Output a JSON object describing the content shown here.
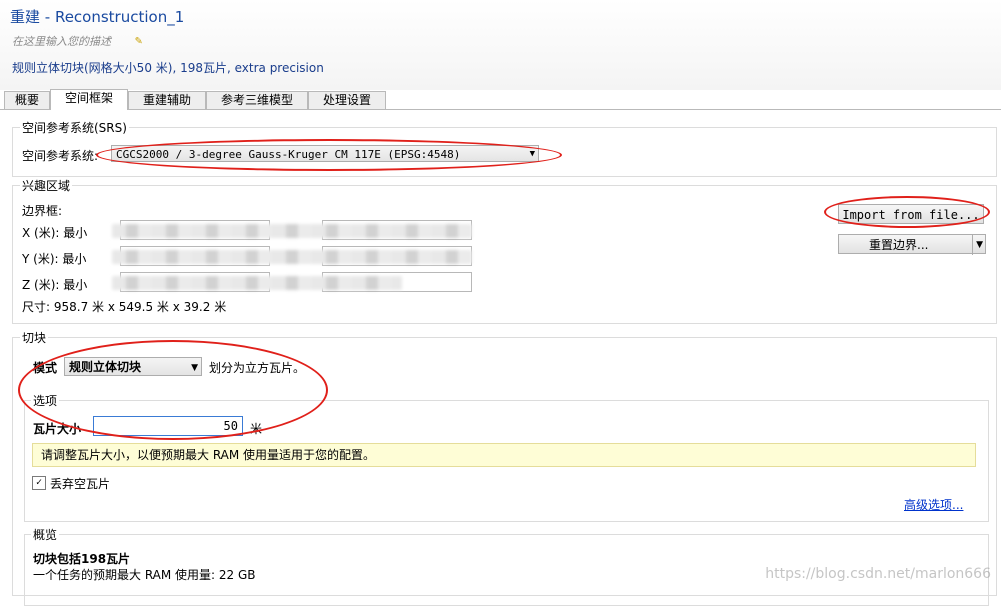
{
  "header": {
    "title": "重建 - Reconstruction_1",
    "description_placeholder": "在这里输入您的描述",
    "pencil_icon": "pencil-icon",
    "subtitle": "规则立体切块(网格大小50 米), 198瓦片, extra precision"
  },
  "tabs": [
    {
      "label": "概要"
    },
    {
      "label": "空间框架",
      "active": true
    },
    {
      "label": "重建辅助"
    },
    {
      "label": "参考三维模型"
    },
    {
      "label": "处理设置"
    }
  ],
  "srs": {
    "group_title": "空间参考系统(SRS)",
    "label": "空间参考系统:",
    "value": "CGCS2000 / 3-degree Gauss-Kruger CM 117E (EPSG:4548)"
  },
  "roi": {
    "group_title": "兴趣区域",
    "bbox_label": "边界框:",
    "x_label": "X (米): 最小",
    "y_label": "Y (米): 最小",
    "z_label": "Z (米): 最小",
    "size_text": "尺寸: 958.7 米 x 549.5 米 x 39.2 米",
    "import_button": "Import from file...",
    "reset_button": "重置边界..."
  },
  "tiling": {
    "group_title": "切块",
    "mode_label": "模式",
    "mode_value": "规则立体切块",
    "mode_desc": "划分为立方瓦片。",
    "options_title": "选项",
    "tile_size_label": "瓦片大小",
    "tile_size_value": "50",
    "tile_size_unit": "米",
    "info_text": "请调整瓦片大小，以便预期最大 RAM 使用量适用于您的配置。",
    "discard_label": "丢弃空瓦片",
    "discard_checked": "✓",
    "advanced_link": "高级选项..."
  },
  "overview": {
    "group_title": "概览",
    "line1": "切块包括198瓦片",
    "line2": "一个任务的预期最大 RAM 使用量: 22 GB"
  },
  "watermark": "https://blog.csdn.net/marlon666",
  "colors": {
    "accent": "#1a4aa0",
    "annotation": "#e0201a",
    "info_bg": "#fefdd6"
  }
}
